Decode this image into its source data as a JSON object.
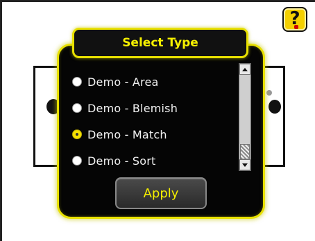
{
  "dialog": {
    "title": "Select Type",
    "options": [
      {
        "label": "Demo - Area",
        "selected": false
      },
      {
        "label": "Demo - Blemish",
        "selected": false
      },
      {
        "label": "Demo - Match",
        "selected": true
      },
      {
        "label": "Demo - Sort",
        "selected": false
      }
    ],
    "apply_label": "Apply",
    "scroll_position": 1.0
  },
  "help": {
    "icon": "help-question-icon",
    "symbol": "?"
  },
  "colors": {
    "accent": "#e8e000",
    "dialog_bg": "#050505",
    "text": "#f2f2f2"
  }
}
